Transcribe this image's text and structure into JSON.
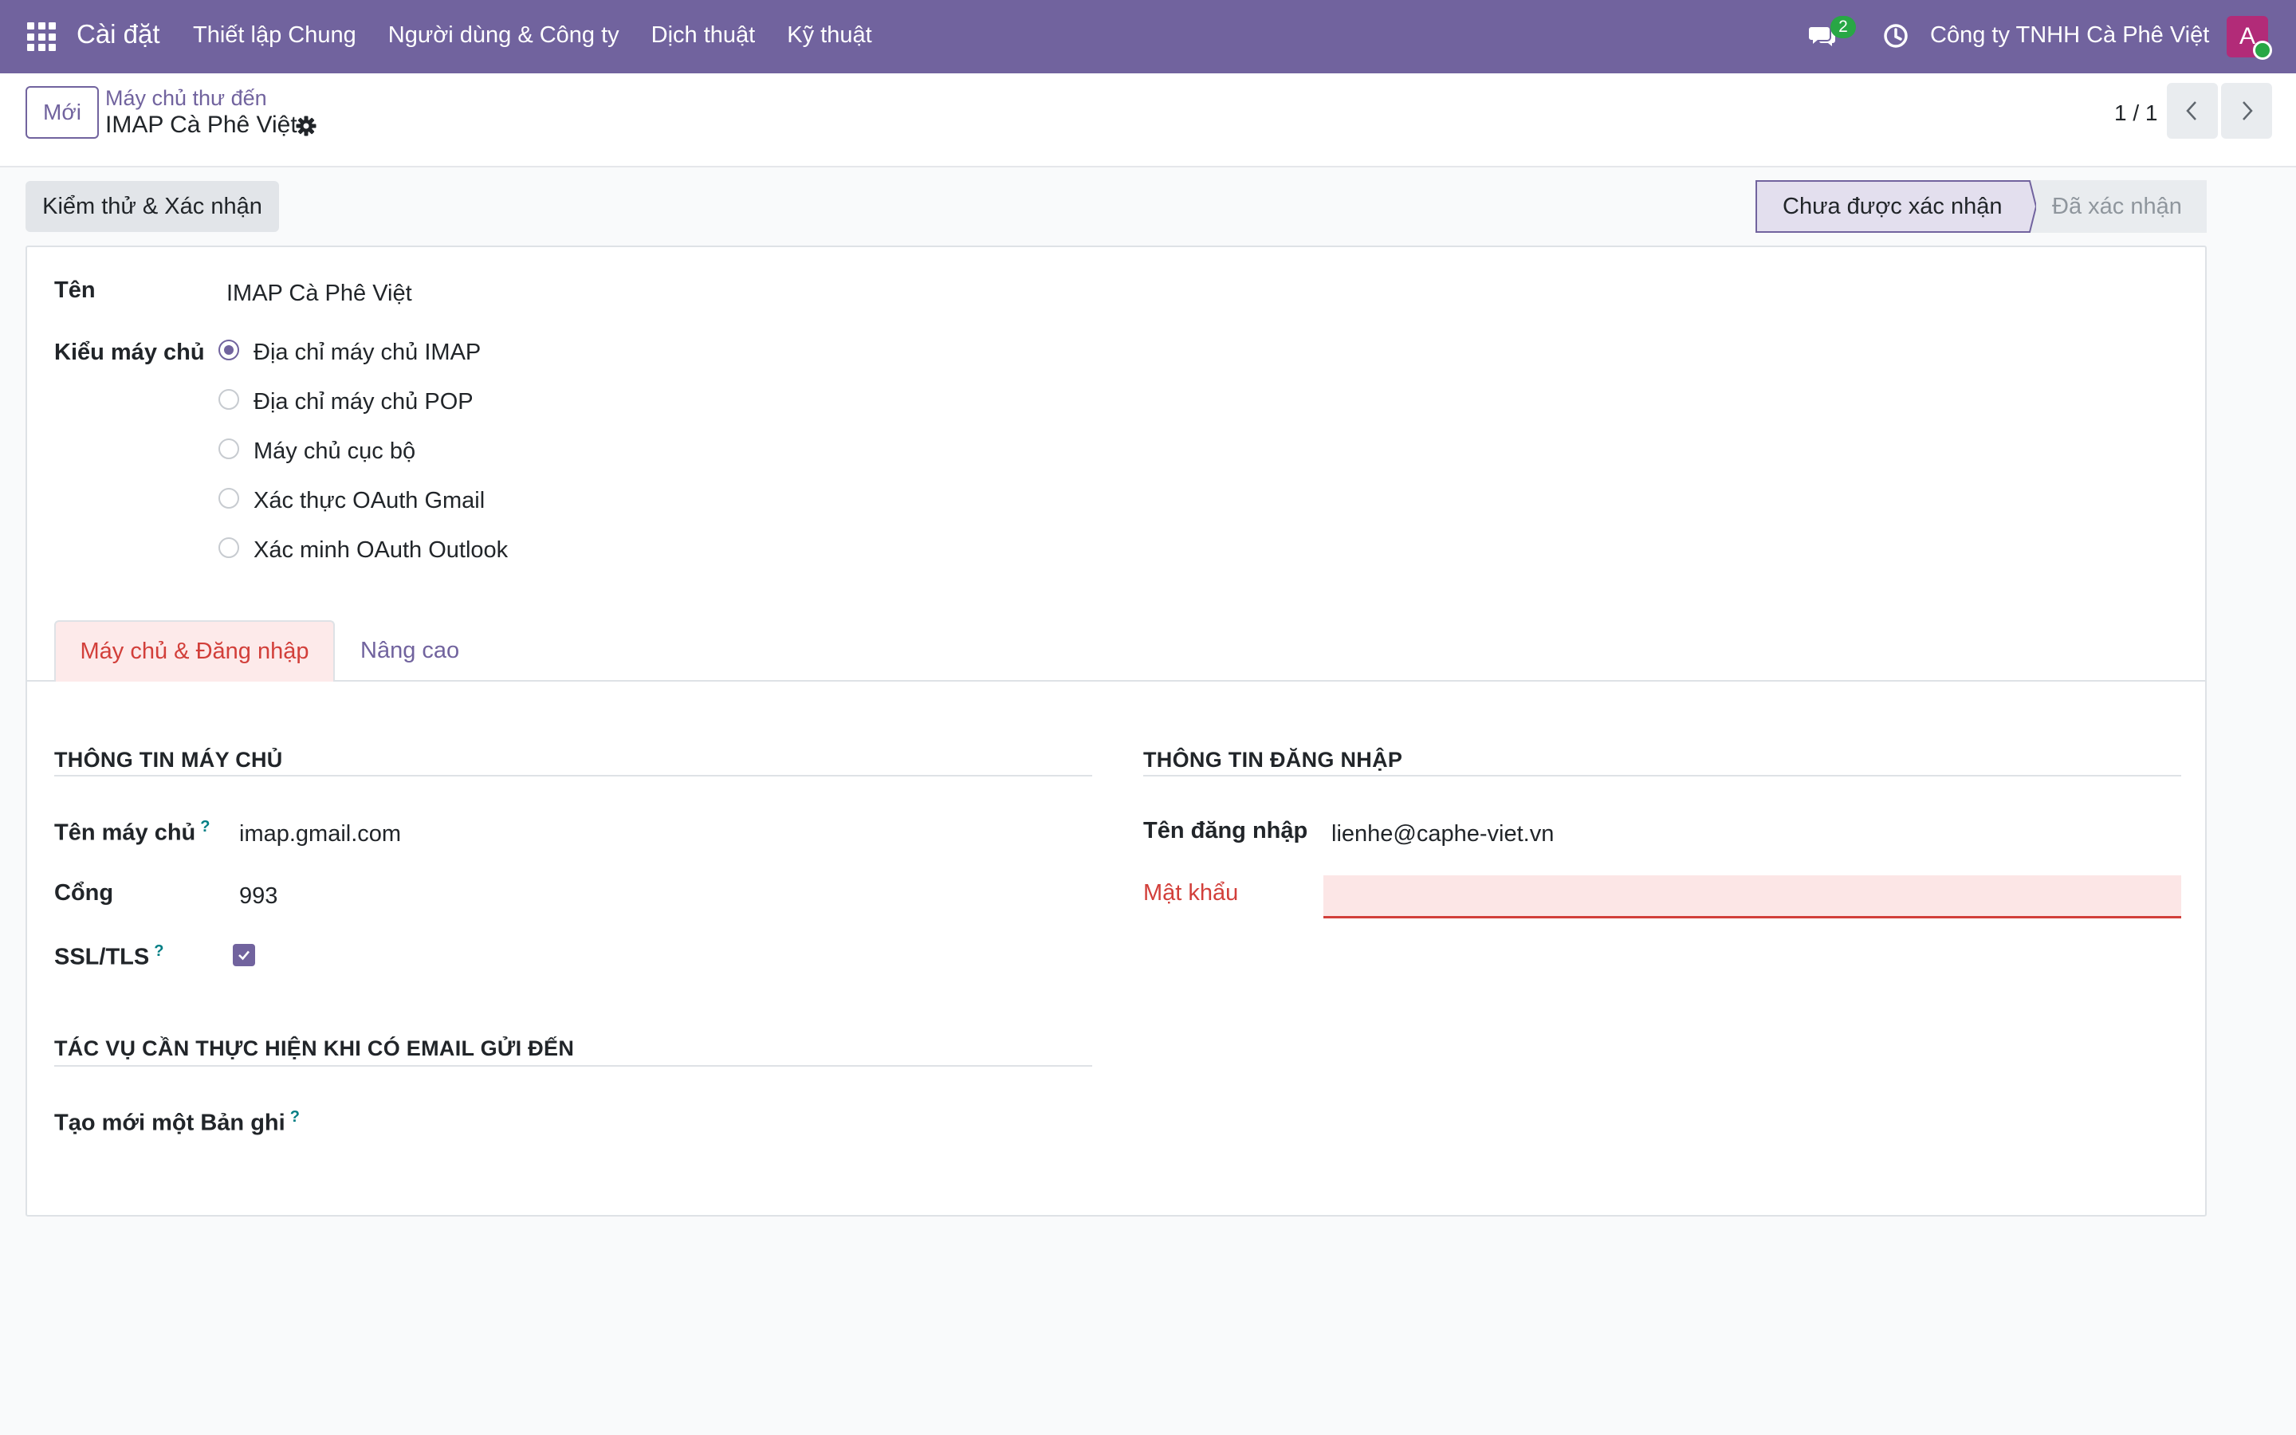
{
  "navbar": {
    "brand": "Cài đặt",
    "menu": [
      "Thiết lập Chung",
      "Người dùng & Công ty",
      "Dịch thuật",
      "Kỹ thuật"
    ],
    "chat_count": "2",
    "company": "Công ty TNHH Cà Phê Việt",
    "avatar_initial": "A"
  },
  "control": {
    "new_label": "Mới",
    "breadcrumb": "Máy chủ thư đến",
    "record_title": "IMAP Cà Phê Việt",
    "pager": "1 / 1"
  },
  "statusbar": {
    "validate_label": "Kiểm thử & Xác nhận",
    "stages": [
      "Chưa được xác nhận",
      "Đã xác nhận"
    ],
    "current_stage": "Chưa được xác nhận"
  },
  "form": {
    "name_label": "Tên",
    "name_value": "IMAP Cà Phê Việt",
    "server_type_label": "Kiểu máy chủ",
    "server_types": [
      {
        "label": "Địa chỉ máy chủ IMAP",
        "selected": true
      },
      {
        "label": "Địa chỉ máy chủ POP",
        "selected": false
      },
      {
        "label": "Máy chủ cục bộ",
        "selected": false
      },
      {
        "label": "Xác thực OAuth Gmail",
        "selected": false
      },
      {
        "label": "Xác minh OAuth Outlook",
        "selected": false
      }
    ],
    "tabs": [
      "Máy chủ & Đăng nhập",
      "Nâng cao"
    ],
    "server_info": {
      "title": "THÔNG TIN MÁY CHỦ",
      "host_label": "Tên máy chủ",
      "host_value": "imap.gmail.com",
      "port_label": "Cổng",
      "port_value": "993",
      "ssl_label": "SSL/TLS",
      "ssl_checked": true
    },
    "login_info": {
      "title": "THÔNG TIN ĐĂNG NHẬP",
      "user_label": "Tên đăng nhập",
      "user_value": "lienhe@caphe-viet.vn",
      "password_label": "Mật khẩu",
      "password_value": ""
    },
    "actions": {
      "title": "TÁC VỤ CẦN THỰC HIỆN KHI CÓ EMAIL GỬI ĐẾN",
      "create_label": "Tạo mới một Bản ghi"
    },
    "help_mark": "?"
  },
  "colors": {
    "brand": "#71639e",
    "error": "#d23f3a",
    "help": "#017e84",
    "success": "#28a745"
  }
}
